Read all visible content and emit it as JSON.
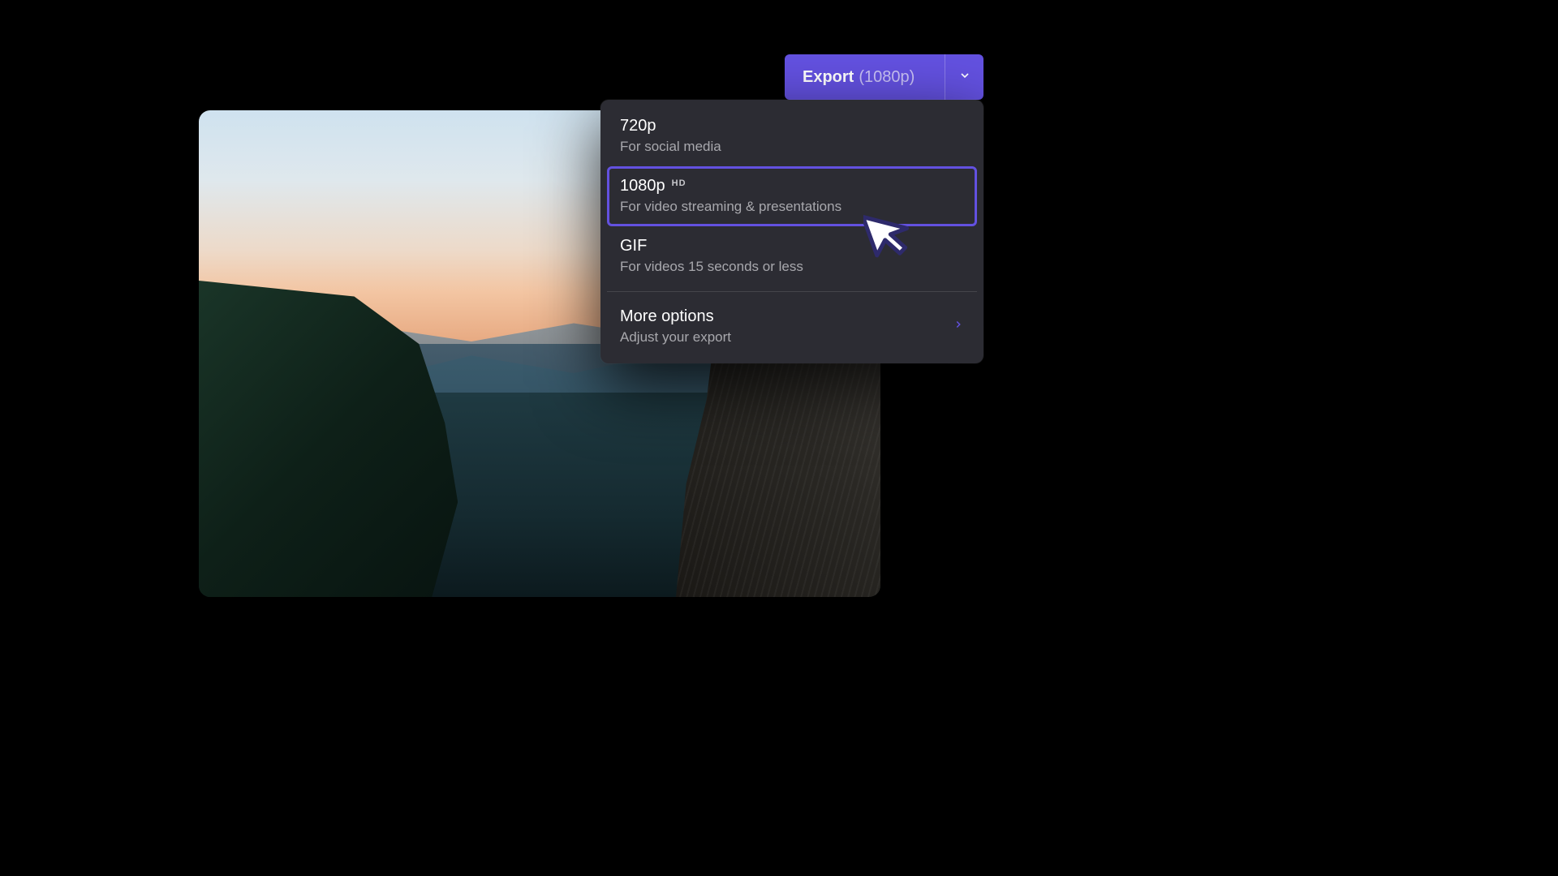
{
  "export_button": {
    "label": "Export",
    "resolution": "(1080p)"
  },
  "dropdown": {
    "options": [
      {
        "title": "720p",
        "subtitle": "For social media",
        "badge": ""
      },
      {
        "title": "1080p",
        "subtitle": "For video streaming & presentations",
        "badge": "HD"
      },
      {
        "title": "GIF",
        "subtitle": "For videos 15 seconds or less",
        "badge": ""
      }
    ],
    "more": {
      "title": "More options",
      "subtitle": "Adjust your export"
    },
    "selected_index": 1
  },
  "colors": {
    "accent": "#6351e0",
    "panel": "#2c2c33"
  }
}
